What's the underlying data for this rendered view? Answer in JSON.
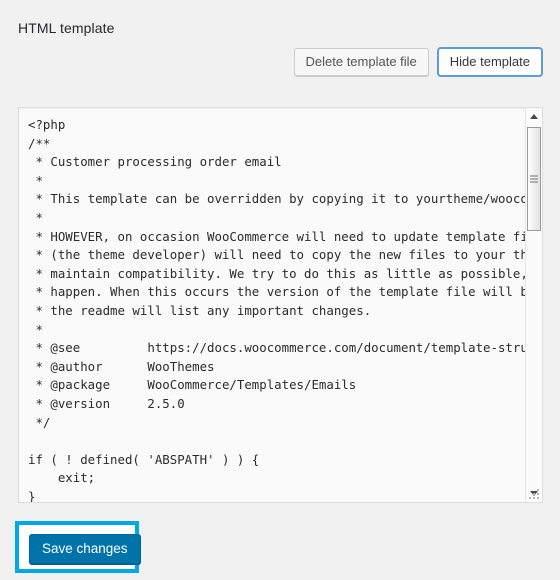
{
  "section": {
    "title": "HTML template"
  },
  "toolbar": {
    "delete_label": "Delete template file",
    "hide_label": "Hide template"
  },
  "editor": {
    "code": "<?php\n/**\n * Customer processing order email\n *\n * This template can be overridden by copying it to yourtheme/woocommer\n *\n * HOWEVER, on occasion WooCommerce will need to update template files \n * (the theme developer) will need to copy the new files to your theme \n * maintain compatibility. We try to do this as little as possible, but\n * happen. When this occurs the version of the template file will be bu\n * the readme will list any important changes.\n *\n * @see         https://docs.woocommerce.com/document/template-structur\n * @author      WooThemes\n * @package     WooCommerce/Templates/Emails\n * @version     2.5.0\n */\n\nif ( ! defined( 'ABSPATH' ) ) {\n    exit;\n}",
    "scrollbar": {
      "up_arrow": "scroll-up",
      "down_arrow": "scroll-down"
    }
  },
  "footer": {
    "save_label": "Save changes"
  },
  "colors": {
    "page_background": "#f1f1f1",
    "primary_button": "#0073aa",
    "highlight_outline": "#00a8e8",
    "focus_ring": "#5b9dd9",
    "editor_background": "#fafafa"
  }
}
